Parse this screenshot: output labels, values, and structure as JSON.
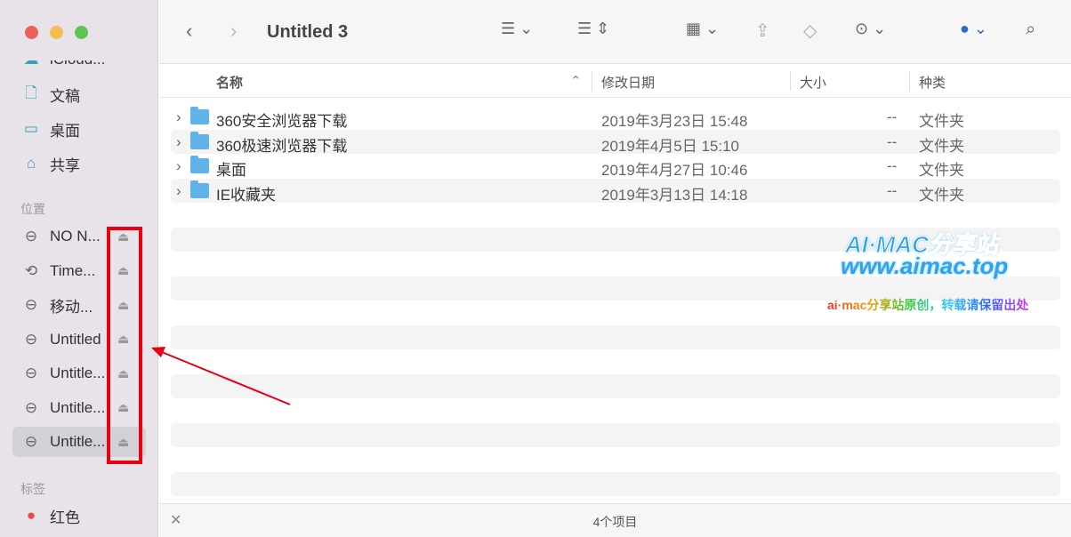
{
  "window": {
    "title": "Untitled 3"
  },
  "sidebar": {
    "favorites": [
      {
        "label": "iCloud...",
        "icon": "cloud-icon"
      },
      {
        "label": "文稿",
        "icon": "document-icon"
      },
      {
        "label": "桌面",
        "icon": "desktop-icon"
      },
      {
        "label": "共享",
        "icon": "shared-folder-icon"
      }
    ],
    "locations_header": "位置",
    "locations": [
      {
        "label": "NO N...",
        "icon": "drive-icon"
      },
      {
        "label": "Time...",
        "icon": "time-machine-icon"
      },
      {
        "label": "移动...",
        "icon": "drive-icon"
      },
      {
        "label": "Untitled",
        "icon": "drive-icon"
      },
      {
        "label": "Untitle...",
        "icon": "drive-icon"
      },
      {
        "label": "Untitle...",
        "icon": "drive-icon"
      },
      {
        "label": "Untitle...",
        "icon": "drive-icon",
        "selected": true
      }
    ],
    "tags_header": "标签",
    "tags": [
      {
        "label": "红色",
        "color": "#e94b3c"
      }
    ]
  },
  "columns": {
    "name": "名称",
    "date": "修改日期",
    "size": "大小",
    "kind": "种类"
  },
  "files": [
    {
      "name": "360安全浏览器下载",
      "date": "2019年3月23日 15:48",
      "size": "--",
      "kind": "文件夹"
    },
    {
      "name": "360极速浏览器下载",
      "date": "2019年4月5日 15:10",
      "size": "--",
      "kind": "文件夹"
    },
    {
      "name": "桌面",
      "date": "2019年4月27日 10:46",
      "size": "--",
      "kind": "文件夹"
    },
    {
      "name": "IE收藏夹",
      "date": "2019年3月13日 14:18",
      "size": "--",
      "kind": "文件夹"
    }
  ],
  "footer": {
    "status": "4个项目"
  },
  "watermark": {
    "line1": "AI·MAC分享站",
    "line2": "www.aimac.top",
    "line3": "ai·mac分享站原创，转载请保留出处"
  },
  "annotation_color": "#e60012"
}
